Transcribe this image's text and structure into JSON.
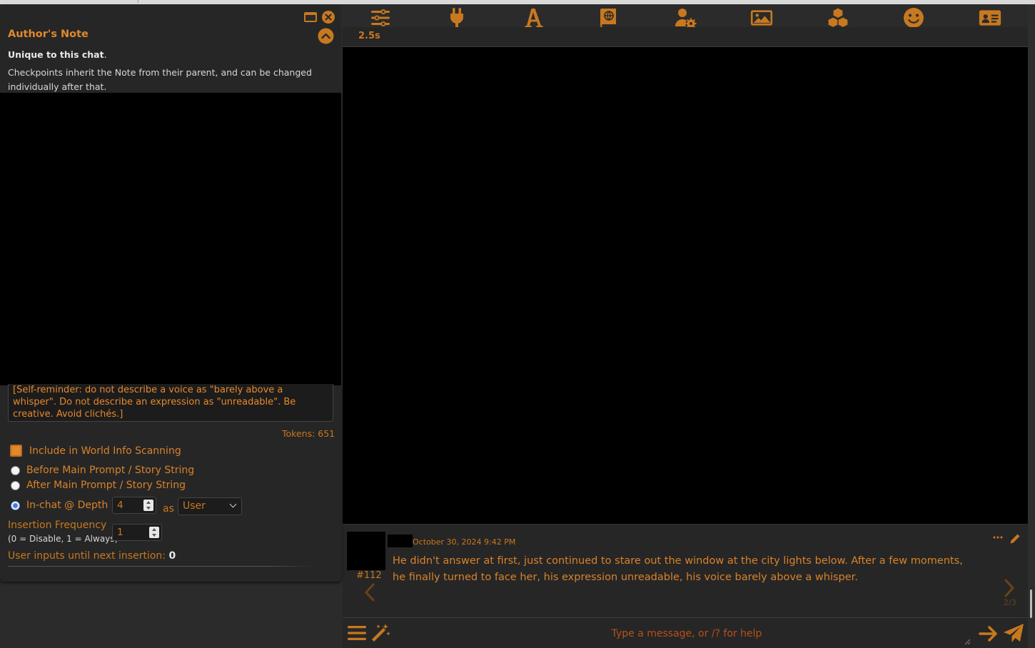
{
  "toolbar": {
    "icons": [
      "sliders-icon",
      "plug-icon",
      "font-icon",
      "book-globe-icon",
      "user-gear-icon",
      "image-icon",
      "cubes-icon",
      "smiley-icon",
      "id-card-icon"
    ]
  },
  "timer": "2.5s",
  "authors_note": {
    "title": "Author's Note",
    "unique_bold": "Unique to this chat",
    "unique_suffix": ".",
    "checkpoint_desc": "Checkpoints inherit the Note from their parent, and can be changed individually after that.",
    "note_text": "[Self-reminder: do not describe a voice as \"barely above a whisper\". Do not describe an expression as \"unreadable\". Be creative. Avoid clichés.]",
    "tokens": "Tokens: 651",
    "include_wi_label": "Include in World Info Scanning",
    "before_main_label": "Before Main Prompt / Story String",
    "after_main_label": "After Main Prompt / Story String",
    "in_chat_label": "In-chat @ Depth",
    "depth_value": "4",
    "as_label": "as",
    "role_value": "User",
    "freq_label": "Insertion Frequency",
    "freq_hint": "(0 = Disable, 1 = Always)",
    "freq_value": "1",
    "user_inputs_label": "User inputs until next insertion:",
    "user_inputs_value": "0"
  },
  "message": {
    "id": "#112",
    "timestamp": "October 30, 2024 9:42 PM",
    "text": "He didn't answer at first, just continued to stare out the window at the city lights below. After a few moments, he finally turned to face her, his expression unreadable, his voice barely above a whisper.",
    "swipe_counter": "2/3"
  },
  "input": {
    "placeholder": "Type a message, or /? for help"
  },
  "colors": {
    "accent": "#c8781e",
    "panel": "#262626",
    "background": "#2b2b2b"
  }
}
